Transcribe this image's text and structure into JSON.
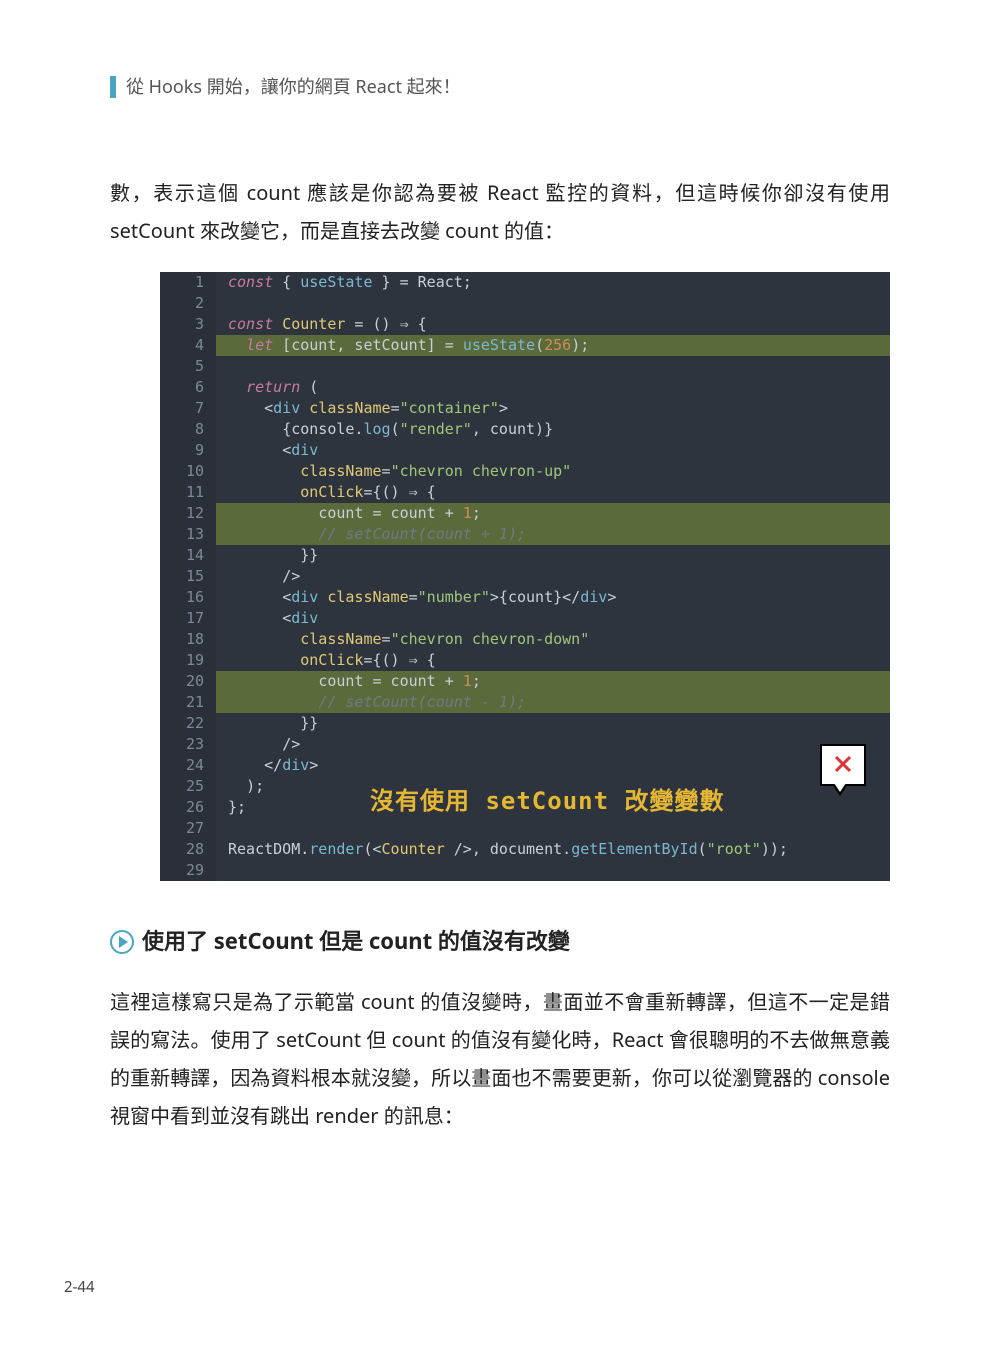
{
  "runningHead": "從 Hooks 開始，讓你的網頁 React 起來！",
  "paragraph1": "數，表示這個 count 應該是你認為要被 React 監控的資料，但這時候你卻沒有使用 setCount 來改變它，而是直接去改變 count 的值：",
  "annotation": "沒有使用 setCount 改變變數",
  "code": {
    "lines": [
      {
        "n": 1,
        "hl": false,
        "segs": [
          {
            "t": "const",
            "c": "kw"
          },
          {
            "t": " { "
          },
          {
            "t": "useState",
            "c": "fn"
          },
          {
            "t": " } = React;"
          }
        ]
      },
      {
        "n": 2,
        "hl": false,
        "segs": []
      },
      {
        "n": 3,
        "hl": false,
        "segs": [
          {
            "t": "const",
            "c": "kw"
          },
          {
            "t": " "
          },
          {
            "t": "Counter",
            "c": "yl"
          },
          {
            "t": " = () ⇒ {"
          }
        ]
      },
      {
        "n": 4,
        "hl": true,
        "segs": [
          {
            "t": "··",
            "c": "indent"
          },
          {
            "t": "let",
            "c": "kw"
          },
          {
            "t": " [count, setCount] = "
          },
          {
            "t": "useState",
            "c": "fn"
          },
          {
            "t": "("
          },
          {
            "t": "256",
            "c": "num"
          },
          {
            "t": ");"
          }
        ]
      },
      {
        "n": 5,
        "hl": false,
        "segs": []
      },
      {
        "n": 6,
        "hl": false,
        "segs": [
          {
            "t": "··",
            "c": "indent"
          },
          {
            "t": "return",
            "c": "kw"
          },
          {
            "t": " ("
          }
        ]
      },
      {
        "n": 7,
        "hl": false,
        "segs": [
          {
            "t": "····",
            "c": "indent"
          },
          {
            "t": "<"
          },
          {
            "t": "div",
            "c": "fn"
          },
          {
            "t": " "
          },
          {
            "t": "className",
            "c": "yl"
          },
          {
            "t": "="
          },
          {
            "t": "\"container\"",
            "c": "str"
          },
          {
            "t": ">"
          }
        ]
      },
      {
        "n": 8,
        "hl": false,
        "segs": [
          {
            "t": "······",
            "c": "indent"
          },
          {
            "t": "{console."
          },
          {
            "t": "log",
            "c": "fn"
          },
          {
            "t": "("
          },
          {
            "t": "\"render\"",
            "c": "str"
          },
          {
            "t": ", count)}"
          }
        ]
      },
      {
        "n": 9,
        "hl": false,
        "segs": [
          {
            "t": "······",
            "c": "indent"
          },
          {
            "t": "<"
          },
          {
            "t": "div",
            "c": "fn"
          }
        ]
      },
      {
        "n": 10,
        "hl": false,
        "segs": [
          {
            "t": "········",
            "c": "indent"
          },
          {
            "t": "className",
            "c": "yl"
          },
          {
            "t": "="
          },
          {
            "t": "\"chevron chevron-up\"",
            "c": "str"
          }
        ]
      },
      {
        "n": 11,
        "hl": false,
        "segs": [
          {
            "t": "········",
            "c": "indent"
          },
          {
            "t": "onClick",
            "c": "yl"
          },
          {
            "t": "={() ⇒ {"
          }
        ]
      },
      {
        "n": 12,
        "hl": true,
        "segs": [
          {
            "t": "··········",
            "c": "indent"
          },
          {
            "t": "count = count + "
          },
          {
            "t": "1",
            "c": "num"
          },
          {
            "t": ";"
          }
        ]
      },
      {
        "n": 13,
        "hl": true,
        "segs": [
          {
            "t": "··········",
            "c": "indent"
          },
          {
            "t": "// setCount(count + 1);",
            "c": "cmt"
          }
        ]
      },
      {
        "n": 14,
        "hl": false,
        "segs": [
          {
            "t": "········",
            "c": "indent"
          },
          {
            "t": "}}"
          }
        ]
      },
      {
        "n": 15,
        "hl": false,
        "segs": [
          {
            "t": "······",
            "c": "indent"
          },
          {
            "t": "/>"
          }
        ]
      },
      {
        "n": 16,
        "hl": false,
        "segs": [
          {
            "t": "······",
            "c": "indent"
          },
          {
            "t": "<"
          },
          {
            "t": "div",
            "c": "fn"
          },
          {
            "t": " "
          },
          {
            "t": "className",
            "c": "yl"
          },
          {
            "t": "="
          },
          {
            "t": "\"number\"",
            "c": "str"
          },
          {
            "t": ">{count}</"
          },
          {
            "t": "div",
            "c": "fn"
          },
          {
            "t": ">"
          }
        ]
      },
      {
        "n": 17,
        "hl": false,
        "segs": [
          {
            "t": "······",
            "c": "indent"
          },
          {
            "t": "<"
          },
          {
            "t": "div",
            "c": "fn"
          }
        ]
      },
      {
        "n": 18,
        "hl": false,
        "segs": [
          {
            "t": "········",
            "c": "indent"
          },
          {
            "t": "className",
            "c": "yl"
          },
          {
            "t": "="
          },
          {
            "t": "\"chevron chevron-down\"",
            "c": "str"
          }
        ]
      },
      {
        "n": 19,
        "hl": false,
        "segs": [
          {
            "t": "········",
            "c": "indent"
          },
          {
            "t": "onClick",
            "c": "yl"
          },
          {
            "t": "={() ⇒ {"
          }
        ]
      },
      {
        "n": 20,
        "hl": true,
        "segs": [
          {
            "t": "··········",
            "c": "indent"
          },
          {
            "t": "count = count + "
          },
          {
            "t": "1",
            "c": "num"
          },
          {
            "t": ";"
          }
        ]
      },
      {
        "n": 21,
        "hl": true,
        "segs": [
          {
            "t": "··········",
            "c": "indent"
          },
          {
            "t": "// setCount(count - 1);",
            "c": "cmt"
          }
        ]
      },
      {
        "n": 22,
        "hl": false,
        "segs": [
          {
            "t": "········",
            "c": "indent"
          },
          {
            "t": "}}"
          }
        ]
      },
      {
        "n": 23,
        "hl": false,
        "segs": [
          {
            "t": "······",
            "c": "indent"
          },
          {
            "t": "/>"
          }
        ]
      },
      {
        "n": 24,
        "hl": false,
        "segs": [
          {
            "t": "····",
            "c": "indent"
          },
          {
            "t": "</"
          },
          {
            "t": "div",
            "c": "fn"
          },
          {
            "t": ">"
          }
        ]
      },
      {
        "n": 25,
        "hl": false,
        "segs": [
          {
            "t": "··",
            "c": "indent"
          },
          {
            "t": ");"
          }
        ]
      },
      {
        "n": 26,
        "hl": false,
        "segs": [
          {
            "t": "};"
          }
        ]
      },
      {
        "n": 27,
        "hl": false,
        "segs": []
      },
      {
        "n": 28,
        "hl": false,
        "segs": [
          {
            "t": "ReactDOM."
          },
          {
            "t": "render",
            "c": "fn"
          },
          {
            "t": "(<"
          },
          {
            "t": "Counter",
            "c": "yl"
          },
          {
            "t": " />, document."
          },
          {
            "t": "getElementById",
            "c": "fn"
          },
          {
            "t": "("
          },
          {
            "t": "\"root\"",
            "c": "str"
          },
          {
            "t": "));"
          }
        ]
      },
      {
        "n": 29,
        "hl": false,
        "segs": []
      }
    ]
  },
  "sectionTitle": "使用了 setCount 但是 count 的值沒有改變",
  "paragraph2": "這裡這樣寫只是為了示範當 count 的值沒變時，畫面並不會重新轉譯，但這不一定是錯誤的寫法。使用了 setCount 但 count 的值沒有變化時，React 會很聰明的不去做無意義的重新轉譯，因為資料根本就沒變，所以畫面也不需要更新，你可以從瀏覽器的 console 視窗中看到並沒有跳出 render 的訊息：",
  "pageNumber": "2-44"
}
